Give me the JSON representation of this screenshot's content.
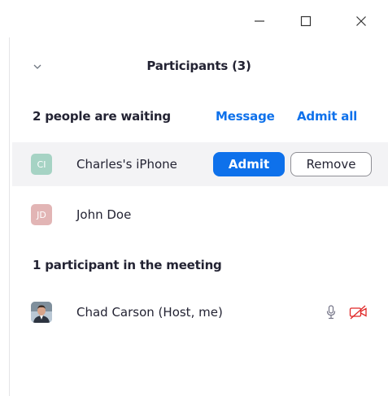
{
  "window": {
    "minimize_icon": "minimize-icon",
    "maximize_icon": "maximize-icon",
    "close_icon": "close-icon"
  },
  "panel": {
    "title": "Participants (3)",
    "collapse_icon": "chevron-down-icon"
  },
  "waiting": {
    "header": "2 people are waiting",
    "message_label": "Message",
    "admit_all_label": "Admit all",
    "people": [
      {
        "initials": "CI",
        "name": "Charles's iPhone",
        "avatar_color": "#a6d3c4",
        "admit_label": "Admit",
        "remove_label": "Remove"
      },
      {
        "initials": "JD",
        "name": "John Doe",
        "avatar_color": "#e2b5b5"
      }
    ]
  },
  "meeting": {
    "header": "1 participant in the meeting",
    "participants": [
      {
        "name": "Chad Carson (Host, me)",
        "mic_icon": "microphone-icon",
        "video_icon": "video-off-icon"
      }
    ]
  },
  "colors": {
    "accent": "#0e71eb",
    "video_off": "#e02828",
    "text": "#232333"
  }
}
